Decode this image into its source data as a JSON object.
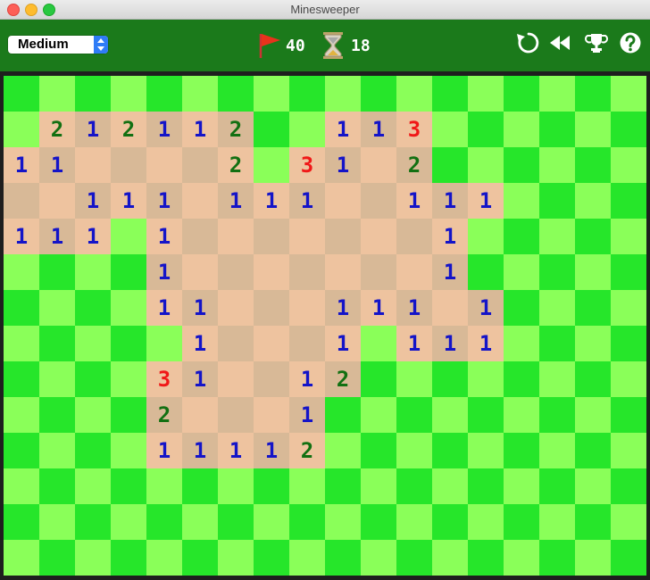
{
  "window": {
    "title": "Minesweeper"
  },
  "toolbar": {
    "difficulty": "Medium",
    "flags": "40",
    "time": "18"
  },
  "colors": {
    "toolbar_bg": "#1b7a1b",
    "unopened_dark": "#26e62a",
    "unopened_light": "#8aff59",
    "opened_a": "#eec39f",
    "opened_b": "#d8b997",
    "num1": "#1414c8",
    "num2": "#127012",
    "num3": "#f01818"
  },
  "icons": [
    "flag-icon",
    "hourglass-icon",
    "restart-icon",
    "undo-icon",
    "trophy-icon",
    "help-icon"
  ],
  "board": {
    "columns": 18,
    "rows": 14,
    "legend": "# = unopened, . = opened empty, 1-9 = opened with number",
    "grid": [
      "##################",
      "#212112##113######",
      "11....2#31.2######",
      "..111.111..111####",
      "111#1.......1#####",
      "####1.......1#####",
      "####11...111.1####",
      "#####1...1#111####",
      "####31..12########",
      "####2...1#########",
      "####11112#########",
      "##################",
      "##################",
      "##################"
    ]
  }
}
